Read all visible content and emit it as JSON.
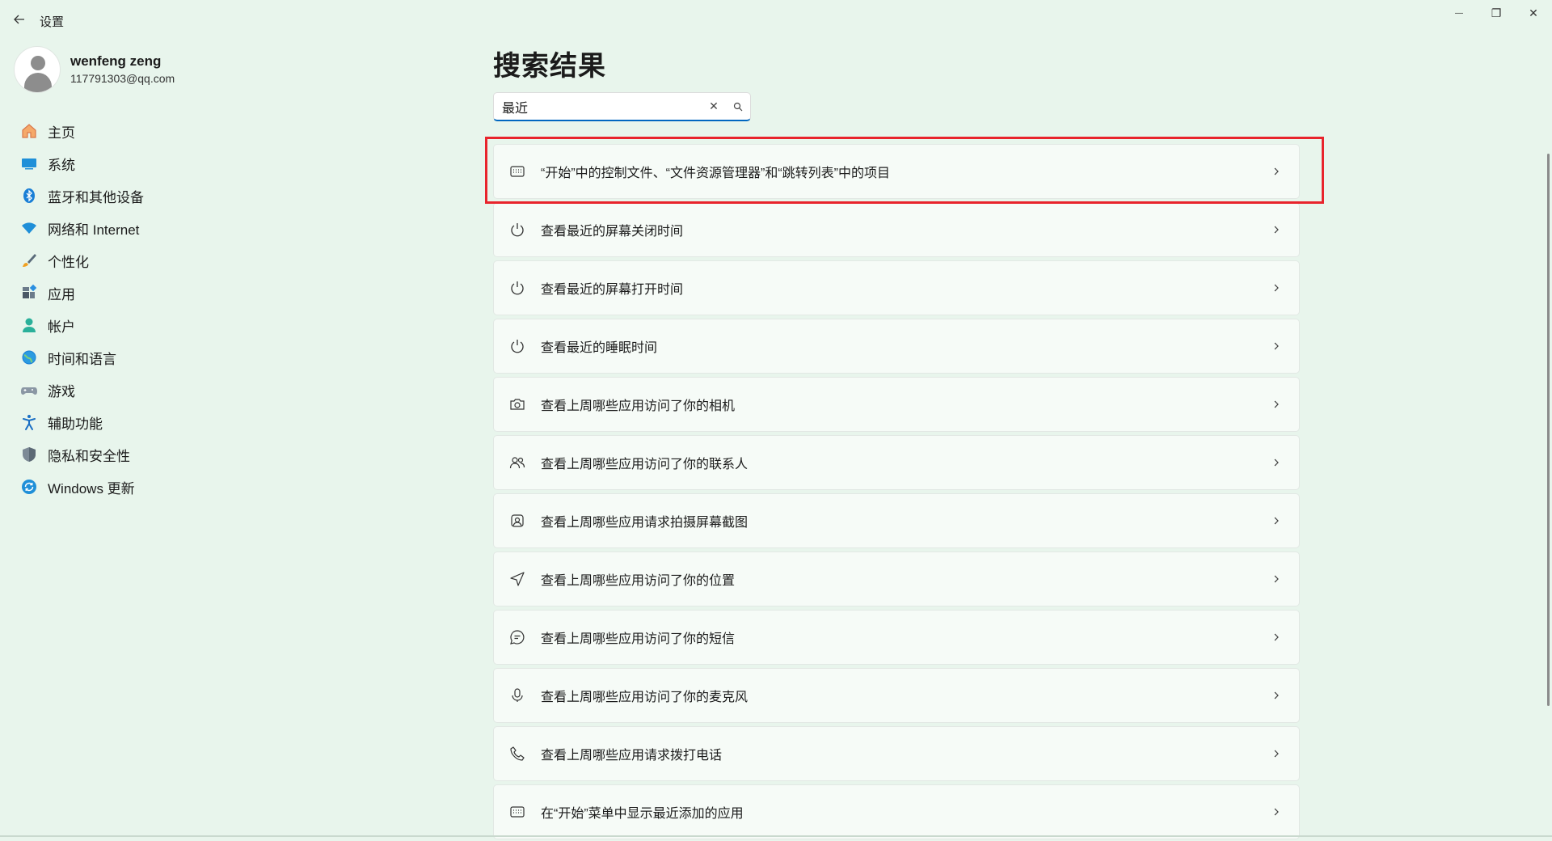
{
  "window": {
    "title": "设置",
    "back_icon": "arrow-left-icon",
    "minimize_glyph": "—",
    "maximize_glyph": "❐",
    "close_glyph": "✕"
  },
  "profile": {
    "name": "wenfeng zeng",
    "email": "117791303@qq.com"
  },
  "nav": {
    "items": [
      {
        "label": "主页",
        "icon": "home-icon"
      },
      {
        "label": "系统",
        "icon": "display-icon"
      },
      {
        "label": "蓝牙和其他设备",
        "icon": "bluetooth-icon"
      },
      {
        "label": "网络和 Internet",
        "icon": "wifi-icon"
      },
      {
        "label": "个性化",
        "icon": "brush-icon"
      },
      {
        "label": "应用",
        "icon": "apps-icon"
      },
      {
        "label": "帐户",
        "icon": "account-icon"
      },
      {
        "label": "时间和语言",
        "icon": "globe-clock-icon"
      },
      {
        "label": "游戏",
        "icon": "gamepad-icon"
      },
      {
        "label": "辅助功能",
        "icon": "accessibility-icon"
      },
      {
        "label": "隐私和安全性",
        "icon": "shield-icon"
      },
      {
        "label": "Windows 更新",
        "icon": "update-icon"
      }
    ]
  },
  "main": {
    "title": "搜索结果",
    "search": {
      "value": "最近",
      "clear_glyph": "✕"
    },
    "results": [
      {
        "label": "“开始”中的控制文件、“文件资源管理器”和“跳转列表”中的项目",
        "icon": "start-menu-icon"
      },
      {
        "label": "查看最近的屏幕关闭时间",
        "icon": "power-icon"
      },
      {
        "label": "查看最近的屏幕打开时间",
        "icon": "power-icon"
      },
      {
        "label": "查看最近的睡眠时间",
        "icon": "power-icon"
      },
      {
        "label": "查看上周哪些应用访问了你的相机",
        "icon": "camera-icon"
      },
      {
        "label": "查看上周哪些应用访问了你的联系人",
        "icon": "contacts-icon"
      },
      {
        "label": "查看上周哪些应用请求拍摄屏幕截图",
        "icon": "screenshot-icon"
      },
      {
        "label": "查看上周哪些应用访问了你的位置",
        "icon": "location-icon"
      },
      {
        "label": "查看上周哪些应用访问了你的短信",
        "icon": "message-icon"
      },
      {
        "label": "查看上周哪些应用访问了你的麦克风",
        "icon": "microphone-icon"
      },
      {
        "label": "查看上周哪些应用请求拨打电话",
        "icon": "phone-icon"
      },
      {
        "label": "在“开始”菜单中显示最近添加的应用",
        "icon": "start-menu-icon"
      }
    ]
  },
  "colors": {
    "background": "#e8f5ec",
    "accent": "#0067c0",
    "highlight": "#e8242c"
  }
}
